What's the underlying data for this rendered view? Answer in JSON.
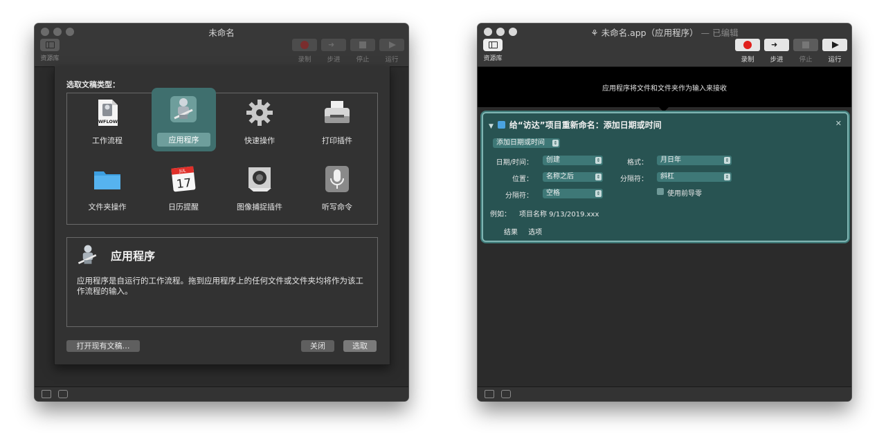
{
  "left": {
    "window_title": "未命名",
    "library_label": "资源库",
    "toolbar": {
      "record": "录制",
      "step": "步进",
      "stop": "停止",
      "run": "运行"
    },
    "sheet": {
      "prompt": "选取文稿类型：",
      "types": [
        {
          "label": "工作流程",
          "icon": "workflow-file-icon",
          "badge": "WFLOW"
        },
        {
          "label": "应用程序",
          "icon": "automator-robot-icon"
        },
        {
          "label": "快速操作",
          "icon": "gear-icon"
        },
        {
          "label": "打印插件",
          "icon": "printer-icon"
        },
        {
          "label": "文件夹操作",
          "icon": "folder-icon"
        },
        {
          "label": "日历提醒",
          "icon": "calendar-icon",
          "month": "JUL",
          "day": "17"
        },
        {
          "label": "图像捕捉插件",
          "icon": "camera-icon"
        },
        {
          "label": "听写命令",
          "icon": "microphone-icon"
        }
      ],
      "selected": "应用程序",
      "description_title": "应用程序",
      "description_body": "应用程序是自运行的工作流程。拖到应用程序上的任何文件或文件夹均将作为该工作流程的输入。",
      "open_existing": "打开现有文稿…",
      "close": "关闭",
      "choose": "选取"
    }
  },
  "right": {
    "window_title": "未命名.app（应用程序）",
    "edited": "— 已编辑",
    "library_label": "资源库",
    "toolbar": {
      "record": "录制",
      "step": "步进",
      "stop": "停止",
      "run": "运行"
    },
    "input_hint": "应用程序将文件和文件夹作为输入来接收",
    "action": {
      "title": "给“访达”项目重新命名：添加日期或时间",
      "mode": "添加日期或时间",
      "date_time_label": "日期/时间：",
      "date_time": "创建",
      "format_label": "格式：",
      "format": "月日年",
      "position_label": "位置：",
      "position": "名称之后",
      "separator_label": "分隔符：",
      "separator": "斜杠",
      "separator2_label": "分隔符：",
      "separator2": "空格",
      "leading_zero": "使用前导零",
      "example_label": "例如：",
      "example": "项目名称 9/13/2019.xxx",
      "tab_results": "结果",
      "tab_options": "选项"
    }
  }
}
